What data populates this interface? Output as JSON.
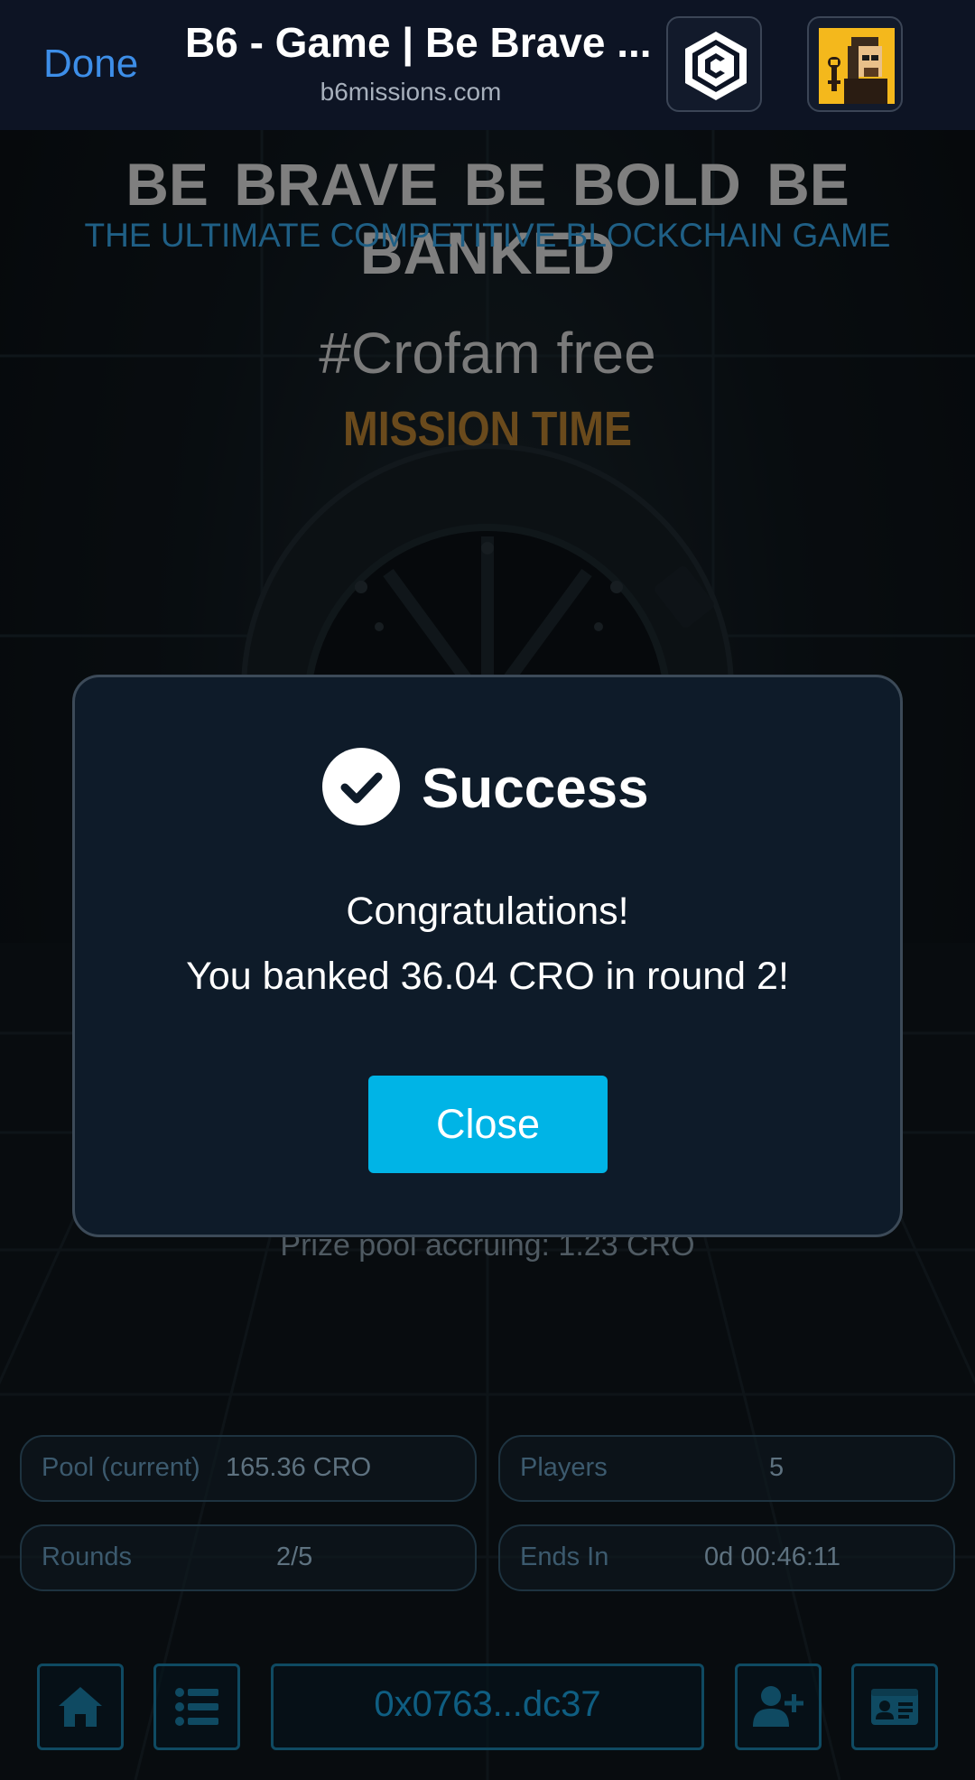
{
  "browser": {
    "done_label": "Done",
    "title": "B6 - Game | Be Brave ...",
    "url": "b6missions.com",
    "icons": [
      "crypto-com-wallet-icon",
      "pixel-avatar-icon"
    ]
  },
  "hero": {
    "tagline": "BE BRAVE  BE BOLD  BE BANKED",
    "subtitle": "THE ULTIMATE COMPETITIVE BLOCKCHAIN GAME"
  },
  "mission": {
    "name": "#Crofam free",
    "time_label": "MISSION TIME"
  },
  "prize_pool": "Prize pool accruing: 1.23 CRO",
  "stats": [
    {
      "label": "Pool (current)",
      "value": "165.36 CRO"
    },
    {
      "label": "Players",
      "value": "5"
    },
    {
      "label": "Rounds",
      "value": "2/5"
    },
    {
      "label": "Ends In",
      "value": "0d 00:46:11"
    }
  ],
  "bottom_nav": {
    "wallet_address": "0x0763...dc37",
    "icons": [
      "home-icon",
      "list-icon",
      "add-user-icon",
      "id-card-icon"
    ]
  },
  "modal": {
    "title": "Success",
    "line1": "Congratulations!",
    "line2": "You banked 36.04 CRO in round 2!",
    "close_label": "Close"
  },
  "colors": {
    "accent": "#00b4e6",
    "done_link": "#3d8ee8",
    "modal_bg": "#0e1b29",
    "page_bg": "#0b1116"
  }
}
